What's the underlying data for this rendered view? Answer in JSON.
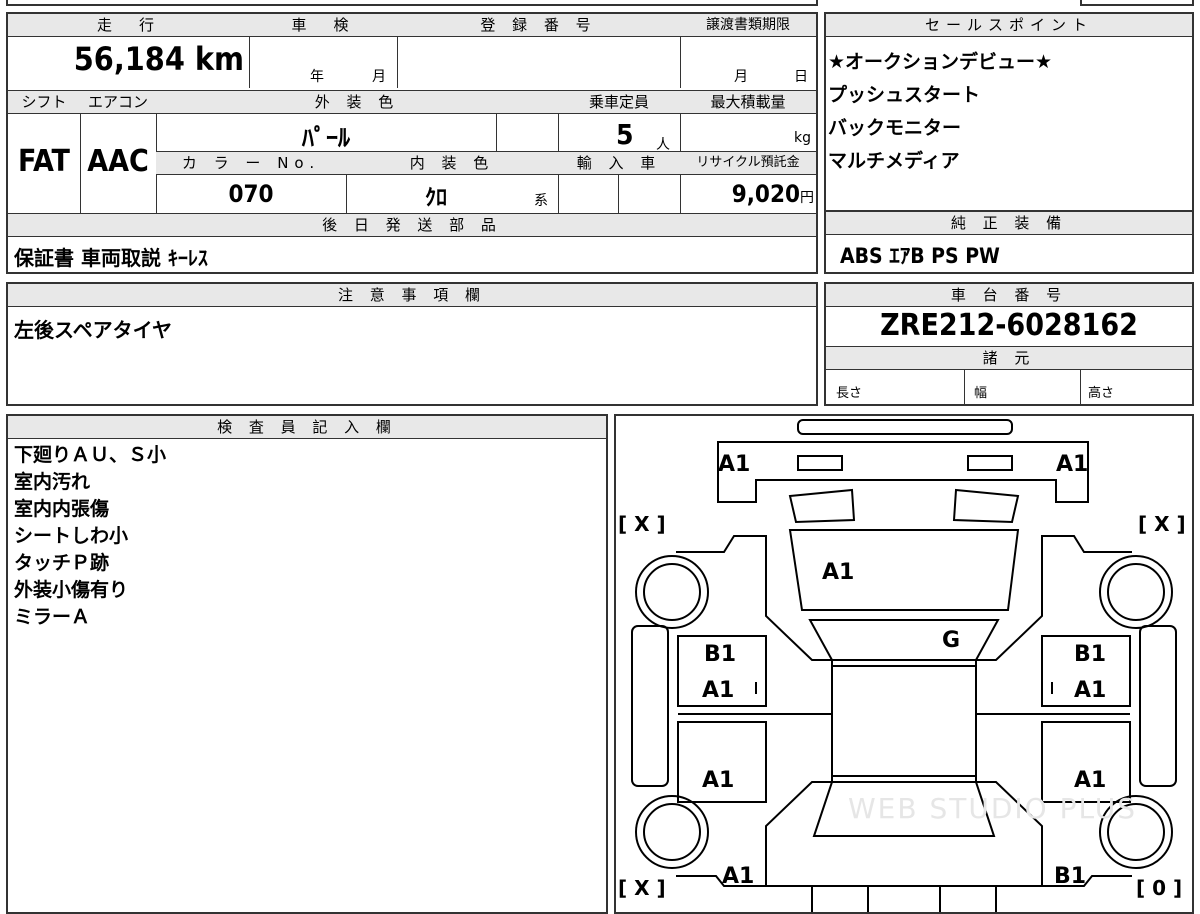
{
  "vehicle": {
    "mileage_label": "走　行",
    "mileage_value": "56,184",
    "mileage_unit": "km",
    "inspection_label": "車　検",
    "inspection_year": "年",
    "inspection_month": "月",
    "registration_label": "登 録 番 号",
    "transfer_label": "譲渡書類期限",
    "transfer_month": "月",
    "transfer_day": "日",
    "shift_label": "シフト",
    "shift_value": "FAT",
    "aircon_label": "エアコン",
    "aircon_value": "AAC",
    "exterior_label": "外 装 色",
    "exterior_value": "ﾊﾟｰﾙ",
    "capacity_label": "乗車定員",
    "capacity_value": "5",
    "capacity_unit": "人",
    "maxload_label": "最大積載量",
    "maxload_unit": "kg",
    "color_no_label": "カ ラ ー No.",
    "color_no_value": "070",
    "interior_label": "内 装 色",
    "interior_value": "ｸﾛ",
    "interior_suffix": "系",
    "import_label": "輸 入 車",
    "recycle_label": "リサイクル預託金",
    "recycle_value": "9,020",
    "recycle_unit": "円",
    "later_parts_label": "後 日 発 送 部 品",
    "later_parts_value": "保証書 車両取説 ｷｰﾚｽ"
  },
  "sales": {
    "label": "セールスポイント",
    "lines": [
      "★オークションデビュー★",
      "プッシュスタート",
      "バックモニター",
      "マルチメディア"
    ]
  },
  "equipment": {
    "label": "純 正 装 備",
    "value": "ABS ｴｱB PS PW"
  },
  "notes": {
    "label": "注 意 事 項 欄",
    "value": "左後スペアタイヤ"
  },
  "chassis": {
    "label": "車 台 番 号",
    "value": "ZRE212-6028162",
    "spec_label": "諸 元",
    "length_label": "長さ",
    "width_label": "幅",
    "height_label": "高さ"
  },
  "inspector": {
    "label": "検 査 員 記 入 欄",
    "lines": [
      "下廻りＡＵ、Ｓ小",
      "室内汚れ",
      "室内内張傷",
      "シートしわ小",
      "タッチＰ跡",
      "外装小傷有り",
      "ミラーＡ"
    ]
  },
  "diagram": {
    "marks": {
      "front_left": "A1",
      "front_right": "A1",
      "hood": "A1",
      "windshield": "G",
      "fl_door_top": "B1",
      "fl_door": "A1",
      "fr_door_top": "B1",
      "fr_door": "A1",
      "rl_door": "A1",
      "rr_door": "A1",
      "rear_left": "A1",
      "rear_right": "B1",
      "tire_fl": "[ X ]",
      "tire_fr": "[ X ]",
      "tire_rl": "[ X ]",
      "tire_rr": "[ 0 ]",
      "small_0": "0"
    },
    "watermark": "WEB STUDIO PLUS"
  }
}
